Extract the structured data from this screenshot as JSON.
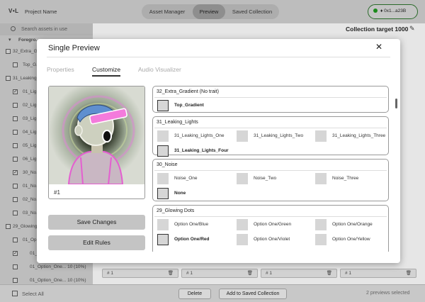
{
  "topbar": {
    "logo": "V•L",
    "project_name": "Project Name",
    "nav": [
      "Asset Manager",
      "Preview",
      "Saved Collection"
    ],
    "wallet": "0x1...a23B"
  },
  "sidebar": {
    "search_placeholder": "Search assets in use",
    "items": [
      {
        "label": "Foregro...",
        "checked": false,
        "head": true
      },
      {
        "label": "32_Extra_G...",
        "checked": false
      },
      {
        "label": "Top_G...",
        "checked": false
      },
      {
        "label": "31_Leaking_L...",
        "checked": false
      },
      {
        "label": "01_Lig...",
        "checked": true
      },
      {
        "label": "02_Lig...",
        "checked": false
      },
      {
        "label": "03_Lig...",
        "checked": false
      },
      {
        "label": "04_Lig...",
        "checked": false
      },
      {
        "label": "05_Lig...",
        "checked": false
      },
      {
        "label": "06_Lig...",
        "checked": false
      },
      {
        "label": "30_No...",
        "checked": true
      },
      {
        "label": "01_No...",
        "checked": false
      },
      {
        "label": "02_No...",
        "checked": false
      },
      {
        "label": "03_No...",
        "checked": false
      },
      {
        "label": "29_Glowing...",
        "checked": false
      },
      {
        "label": "01_Op...",
        "checked": false
      },
      {
        "label": "01_Op...",
        "checked": true
      },
      {
        "label": "01_Option_One... 10 (10%)",
        "checked": false
      },
      {
        "label": "01_Option_One... 10 (10%)",
        "checked": false
      }
    ]
  },
  "main": {
    "collection_target": "Collection target 1000",
    "tile_labels": [
      "# 1",
      "# 1",
      "# 1",
      "# 1"
    ]
  },
  "bottombar": {
    "select_all": "Select All",
    "delete": "Delete",
    "add_saved": "Add to Saved Collection",
    "count": "2 previews selected"
  },
  "modal": {
    "title": "Single Preview",
    "tabs": [
      "Properties",
      "Customize",
      "Audio Visualizer"
    ],
    "active_tab": "Customize",
    "preview_tag": "#1",
    "save": "Save Changes",
    "edit_rules": "Edit Rules",
    "groups": [
      {
        "title": "32_Extra_Gradient (No trait)",
        "options": [
          {
            "label": "Top_Gradient",
            "selected": true
          }
        ]
      },
      {
        "title": "31_Leaking_Lights",
        "options": [
          {
            "label": "31_Leaking_Lights_One",
            "selected": false
          },
          {
            "label": "31_Leaking_Lights_Two",
            "selected": false
          },
          {
            "label": "31_Leaking_Lights_Three",
            "selected": false
          },
          {
            "label": "31_Leaking_Lights_Four",
            "selected": true
          }
        ]
      },
      {
        "title": "30_Noise",
        "options": [
          {
            "label": "Noise_One",
            "selected": false
          },
          {
            "label": "Noise_Two",
            "selected": false
          },
          {
            "label": "Noise_Three",
            "selected": false
          },
          {
            "label": "None",
            "selected": true
          }
        ]
      },
      {
        "title": "29_Glowing Dots",
        "options": [
          {
            "label": "Option One/Blue",
            "selected": false
          },
          {
            "label": "Option One/Green",
            "selected": false
          },
          {
            "label": "Option One/Orange",
            "selected": false
          },
          {
            "label": "Option One/Red",
            "selected": true
          },
          {
            "label": "Option One/Violet",
            "selected": false
          },
          {
            "label": "Option One/Yellow",
            "selected": false
          }
        ]
      }
    ]
  },
  "colors": {
    "accent_wallet": "#2a6a2a",
    "artwork_pink": "#e45fd0",
    "artwork_blue": "#5f8fd0"
  }
}
